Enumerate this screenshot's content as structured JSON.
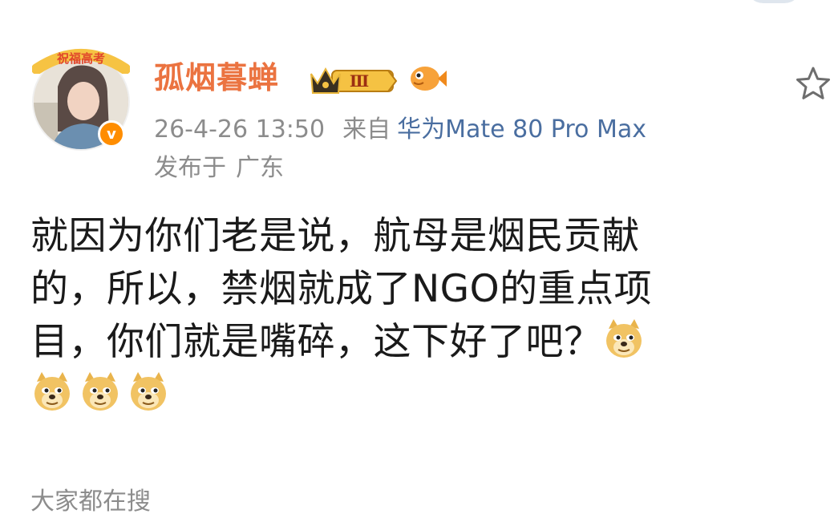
{
  "post": {
    "author": {
      "name": "孤烟暮蝉",
      "avatar_frame_text": "祝福高考",
      "verified_icon": "verified-v-icon",
      "level_badge": "Ⅲ",
      "badge_icon": "crown-badge-icon",
      "extra_icon": "fish-icon"
    },
    "meta": {
      "time": "26-4-26 13:50",
      "from_label": "来自",
      "device": "华为Mate 80 Pro Max",
      "location_label": "发布于",
      "location": "广东"
    },
    "content_lines": [
      "就因为你们老是说，航母是烟民贡献",
      "的，所以，禁烟就成了NGO的重点项",
      "目，你们就是嘴碎，这下好了吧？"
    ],
    "emoji_name": "doge-emoji",
    "footer_partial": "大家都在搜"
  },
  "colors": {
    "username": "#eb7340",
    "meta_gray": "#8c8c8c",
    "device_blue": "#4a6ea0",
    "verified_orange": "#ff8d00"
  }
}
